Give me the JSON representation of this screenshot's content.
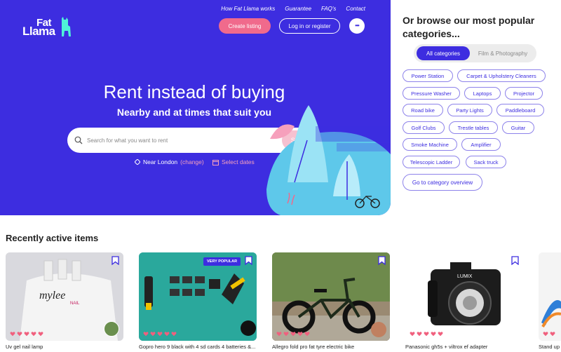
{
  "header": {
    "logo_line1": "Fat",
    "logo_line2": "Llama",
    "nav": [
      "How Fat Llama works",
      "Guarantee",
      "FAQ's",
      "Contact"
    ],
    "create_listing": "Create listing",
    "login": "Log in or register",
    "more": "•••"
  },
  "hero": {
    "title": "Rent instead of buying",
    "subtitle": "Nearby and at times that suit you",
    "search_placeholder": "Search for what you want to rent",
    "search_button": "Search",
    "location": "Near London",
    "location_change": "(change)",
    "dates": "Select dates"
  },
  "browse": {
    "title": "Or browse our most popular categories...",
    "tabs": [
      "All categories",
      "Film & Photography"
    ],
    "chips": [
      "Power Station",
      "Carpet & Upholstery Cleaners",
      "Pressure Washer",
      "Laptops",
      "Projector",
      "Road bike",
      "Party Lights",
      "Paddleboard",
      "Golf Clubs",
      "Trestle tables",
      "Guitar",
      "Smoke Machine",
      "Amplifier",
      "Telescopic Ladder",
      "Sack truck"
    ],
    "overview": "Go to category overview"
  },
  "recent": {
    "title": "Recently active items",
    "items": [
      {
        "title": "Uv gel nail lamp",
        "badge": "",
        "image_text": "mylee"
      },
      {
        "title": "Gopro hero 9 black with 4 sd cards 4 batteries &...",
        "badge": "VERY POPULAR",
        "image_text": ""
      },
      {
        "title": "Allegro fold pro fat tyre electric bike",
        "badge": "",
        "image_text": ""
      },
      {
        "title": "Panasonic gh5s + viltrox ef adapter",
        "badge": "",
        "image_text": "LUMIX"
      },
      {
        "title": "Stand up",
        "badge": "",
        "image_text": ""
      }
    ]
  },
  "colors": {
    "brand": "#3d2de0",
    "accent": "#f06a8c",
    "heart": "#f0607e"
  }
}
